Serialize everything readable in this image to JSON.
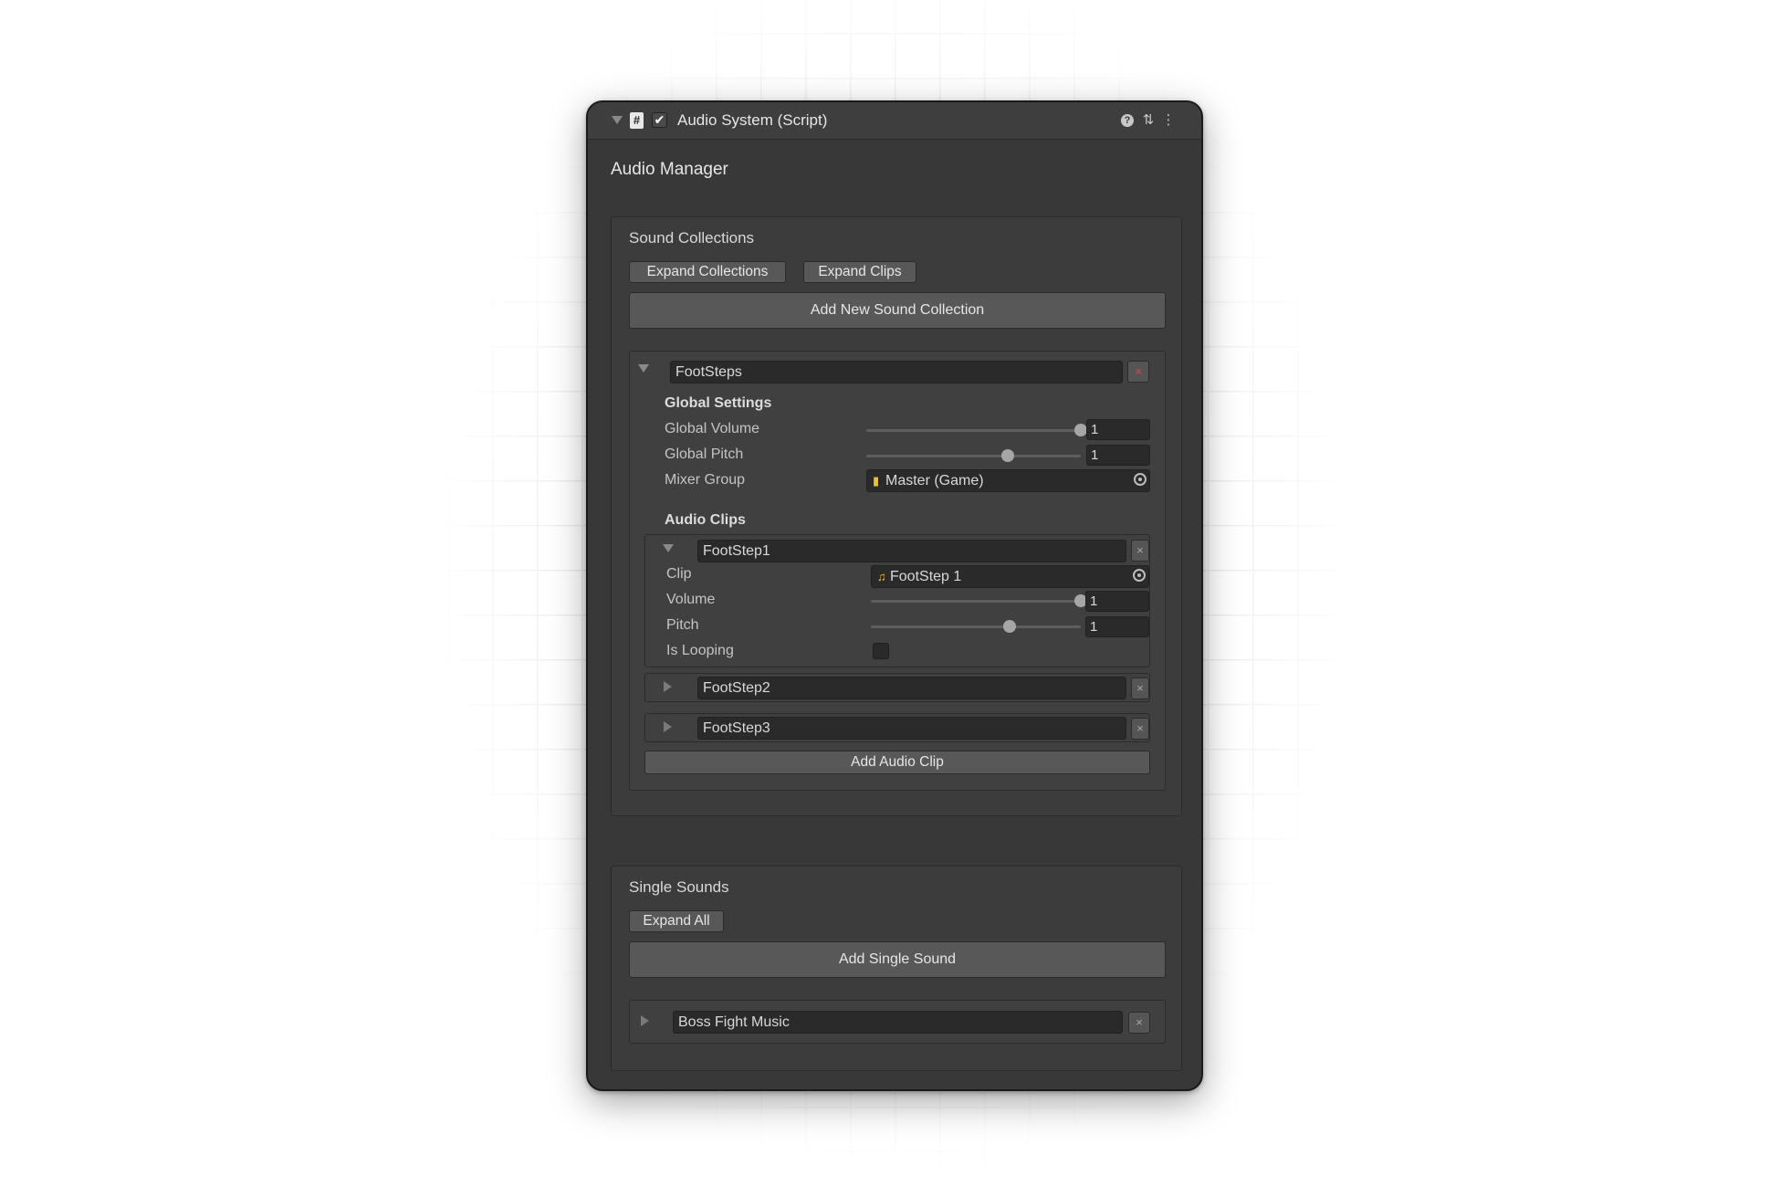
{
  "window": {
    "title": "Audio System (Script)",
    "component_enabled": true,
    "icons": [
      "foldout-triangle-icon",
      "script-icon",
      "enabled-checkbox",
      "help-icon",
      "presets-icon",
      "kebab-menu-icon"
    ],
    "help_glyph": "?",
    "script_glyph": "#",
    "presets_glyph": "⇅",
    "menu_glyph": "⋮"
  },
  "heading": "Audio Manager",
  "collections": {
    "title": "Sound Collections",
    "expand_collections_label": "Expand Collections",
    "expand_clips_label": "Expand Clips",
    "add_collection_label": "Add New Sound Collection",
    "collection": {
      "name": "FootSteps",
      "expanded": true,
      "delete_glyph": "×",
      "global_settings": {
        "title": "Global Settings",
        "global_volume_label": "Global Volume",
        "global_volume_value": "1",
        "global_volume_fraction": 1.0,
        "global_pitch_label": "Global Pitch",
        "global_pitch_value": "1",
        "global_pitch_fraction": 0.66,
        "mixer_group_label": "Mixer Group",
        "mixer_group_value": "Master (Game)",
        "mixer_icon": "mixer-group-icon"
      },
      "audio_clips_title": "Audio Clips",
      "clips": [
        {
          "name": "FootStep1",
          "expanded": true,
          "clip_label": "Clip",
          "clip_value": "FootStep 1",
          "clip_icon": "audio-clip-icon",
          "volume_label": "Volume",
          "volume_value": "1",
          "volume_fraction": 1.0,
          "pitch_label": "Pitch",
          "pitch_value": "1",
          "pitch_fraction": 0.66,
          "looping_label": "Is Looping",
          "is_looping": false
        },
        {
          "name": "FootStep2",
          "expanded": false
        },
        {
          "name": "FootStep3",
          "expanded": false
        }
      ],
      "add_clip_label": "Add Audio Clip",
      "delete_glyph_small": "×"
    }
  },
  "single_sounds": {
    "title": "Single Sounds",
    "expand_all_label": "Expand All",
    "add_label": "Add Single Sound",
    "items": [
      {
        "name": "Boss Fight Music",
        "expanded": false
      }
    ]
  }
}
